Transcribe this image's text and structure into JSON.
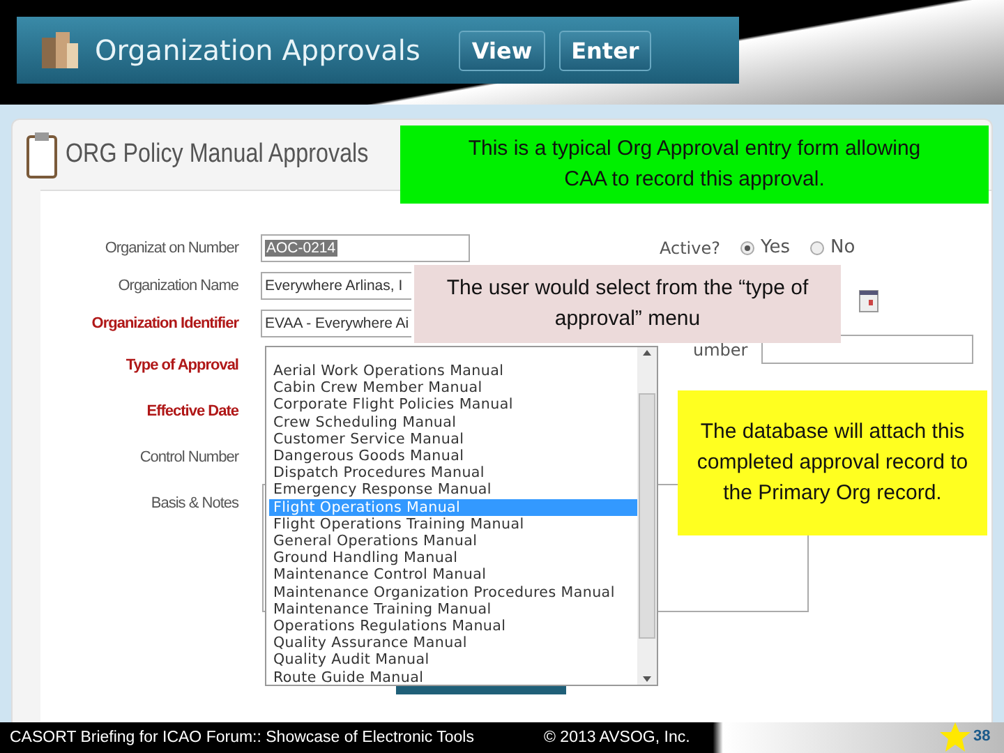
{
  "header": {
    "title": "Organization Approvals",
    "buttons": [
      {
        "label": "View"
      },
      {
        "label": "Enter"
      }
    ]
  },
  "panel": {
    "title": "ORG Policy Manual Approvals"
  },
  "form": {
    "fields": [
      {
        "label": "Organizat on Number",
        "required": false,
        "value": "AOC-0214",
        "highlighted": true
      },
      {
        "label": "Organization Name",
        "required": false,
        "value": "Everywhere Arlinas, I",
        "highlighted": false
      },
      {
        "label": "Organization Identifier",
        "required": true,
        "value": "EVAA - Everywhere Ai",
        "highlighted": false
      },
      {
        "label": "Type of Approval",
        "required": true
      },
      {
        "label": "Effective Date",
        "required": true
      },
      {
        "label": "Control Number",
        "required": false
      },
      {
        "label": "Basis & Notes",
        "required": false
      }
    ],
    "active": {
      "label": "Active?",
      "options": [
        {
          "label": "Yes",
          "selected": true
        },
        {
          "label": "No",
          "selected": false
        }
      ]
    },
    "side_label": "umber"
  },
  "dropdown": {
    "items": [
      {
        "label": "Aerial Work Operations Manual",
        "selected": false
      },
      {
        "label": "Cabin Crew Member Manual",
        "selected": false
      },
      {
        "label": "Corporate Flight Policies Manual",
        "selected": false
      },
      {
        "label": "Crew Scheduling Manual",
        "selected": false
      },
      {
        "label": "Customer Service Manual",
        "selected": false
      },
      {
        "label": "Dangerous Goods Manual",
        "selected": false
      },
      {
        "label": "Dispatch Procedures Manual",
        "selected": false
      },
      {
        "label": "Emergency Response Manual",
        "selected": false
      },
      {
        "label": "Flight Operations Manual",
        "selected": true
      },
      {
        "label": "Flight Operations Training Manual",
        "selected": false
      },
      {
        "label": "General Operations Manual",
        "selected": false
      },
      {
        "label": "Ground Handling Manual",
        "selected": false
      },
      {
        "label": "Maintenance Control Manual",
        "selected": false
      },
      {
        "label": "Maintenance Organization Procedures Manual",
        "selected": false
      },
      {
        "label": "Maintenance Training Manual",
        "selected": false
      },
      {
        "label": "Operations Regulations Manual",
        "selected": false
      },
      {
        "label": "Quality Assurance Manual",
        "selected": false
      },
      {
        "label": "Quality Audit Manual",
        "selected": false
      },
      {
        "label": "Route Guide Manual",
        "selected": false
      }
    ]
  },
  "callouts": [
    {
      "text": "This is a typical Org Approval entry form allowing CAA to record this approval.",
      "color": "#00f000"
    },
    {
      "text": "The user would select from the “type of approval” menu",
      "color": "#ecdada"
    },
    {
      "text": "The database will attach this completed  approval record to the Primary Org record.",
      "color": "#ffff20"
    }
  ],
  "footer": {
    "left": "CASORT Briefing for ICAO Forum:: Showcase of Electronic Tools",
    "copyright": "© 2013 AVSOG, Inc.",
    "page": "38"
  }
}
